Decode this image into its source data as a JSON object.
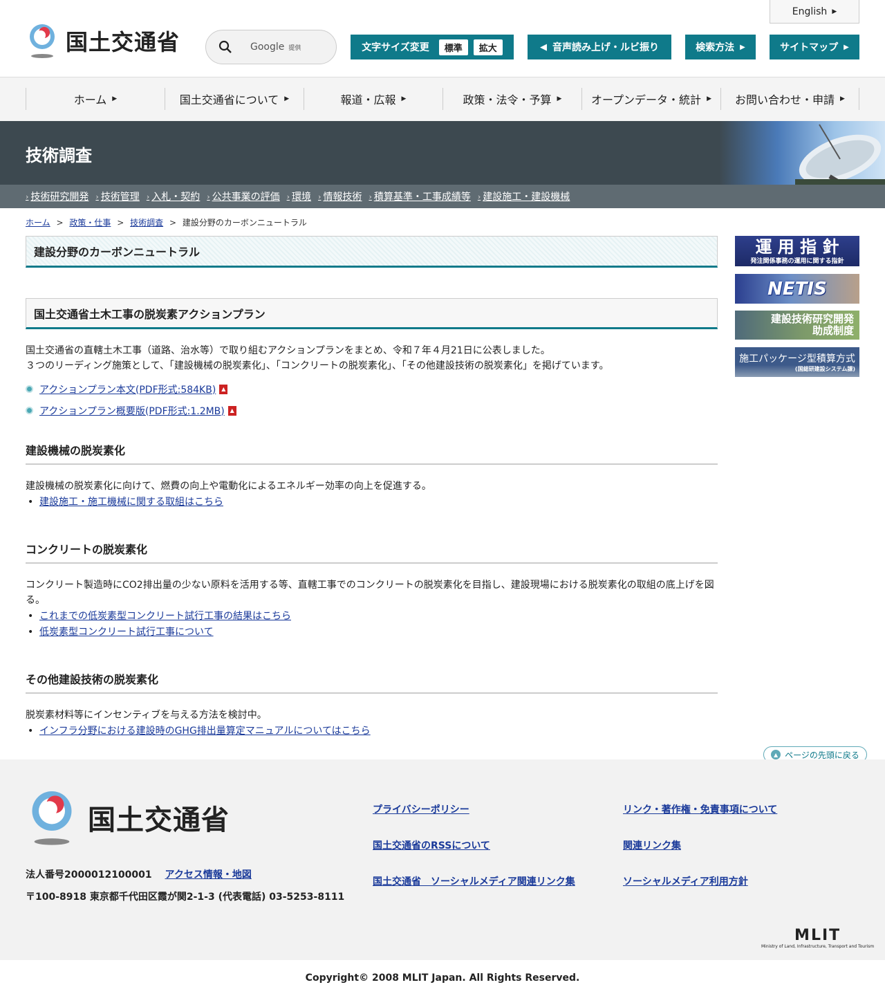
{
  "header": {
    "site_name": "国土交通省",
    "english_label": "English",
    "search_brand": "Google",
    "search_sub": "提供",
    "font_size_label": "文字サイズ変更",
    "font_standard": "標準",
    "font_large": "拡大",
    "voice_label": "音声読み上げ・ルビ振り",
    "search_method_label": "検索方法",
    "sitemap_label": "サイトマップ",
    "accent_color": "#0f7a8a"
  },
  "gnav": [
    {
      "label": "ホーム"
    },
    {
      "label": "国土交通省について"
    },
    {
      "label": "報道・広報"
    },
    {
      "label": "政策・法令・予算"
    },
    {
      "label": "オープンデータ・統計"
    },
    {
      "label": "お問い合わせ・申請"
    }
  ],
  "banner": {
    "title": "技術調査"
  },
  "subnav": [
    {
      "label": "技術研究開発"
    },
    {
      "label": "技術管理"
    },
    {
      "label": "入札・契約"
    },
    {
      "label": "公共事業の評価"
    },
    {
      "label": "環境"
    },
    {
      "label": "情報技術"
    },
    {
      "label": "積算基準・工事成績等"
    },
    {
      "label": "建設施工・建設機械"
    }
  ],
  "breadcrumb": {
    "home": "ホーム",
    "policy": "政策・仕事",
    "tech": "技術調査",
    "current": "建設分野のカーボンニュートラル",
    "sep": ">"
  },
  "main": {
    "page_title": "建設分野のカーボンニュートラル",
    "section1": {
      "heading": "国土交通省土木工事の脱炭素アクションプラン",
      "para1": "国土交通省の直轄土木工事（道路、治水等）で取り組むアクションプランをまとめ、令和７年４月21日に公表しました。",
      "para2": "３つのリーディング施策として、「建設機械の脱炭素化」、「コンクリートの脱炭素化」、「その他建設技術の脱炭素化」を掲げています。",
      "links": [
        {
          "label": "アクションプラン本文(PDF形式:584KB)"
        },
        {
          "label": "アクションプラン概要版(PDF形式:1.2MB)"
        }
      ]
    },
    "section2": {
      "heading": "建設機械の脱炭素化",
      "text": "建設機械の脱炭素化に向けて、燃費の向上や電動化によるエネルギー効率の向上を促進する。",
      "links": [
        {
          "label": "建設施工・施工機械に関する取組はこちら"
        }
      ]
    },
    "section3": {
      "heading": "コンクリートの脱炭素化",
      "text_line1": "コンクリート製造時にCO2排出量の少ない原料を活用する等、直轄工事でのコンクリートの脱炭素化を目指し、建設現場における脱炭素化の取組の底上げを図",
      "text_line2": "る。",
      "links": [
        {
          "label": "これまでの低炭素型コンクリート試行工事の結果はこちら"
        },
        {
          "label": "低炭素型コンクリート試行工事について"
        }
      ]
    },
    "section4": {
      "heading": "その他建設技術の脱炭素化",
      "text": "脱炭素材料等にインセンティブを与える方法を検討中。",
      "links": [
        {
          "label": "インフラ分野における建設時のGHG排出量算定マニュアルについてはこちら"
        }
      ]
    }
  },
  "sidebar": {
    "b1_title": "運 用 指 針",
    "b1_sub": "発注関係事務の運用に関する指針",
    "b2_title": "NETIS",
    "b3_line1": "建設技術研究開発",
    "b3_line2": "助成制度",
    "b4_title": "施工パッケージ型積算方式",
    "b4_sub": "(国総研建設システム課)"
  },
  "pagetop": {
    "label": "ページの先頭に戻る"
  },
  "footer": {
    "site_name": "国土交通省",
    "corp_number": "法人番号2000012100001",
    "access_link": "アクセス情報・地図",
    "address": "〒100-8918 東京都千代田区霞が関2-1-3 (代表電話) 03-5253-8111",
    "links": [
      {
        "label": "プライバシーポリシー"
      },
      {
        "label": "リンク・著作権・免責事項について"
      },
      {
        "label": "国土交通省のRSSについて"
      },
      {
        "label": "関連リンク集"
      },
      {
        "label": "国土交通省　ソーシャルメディア関連リンク集"
      },
      {
        "label": "ソーシャルメディア利用方針"
      }
    ],
    "mlit_logo": "MLIT",
    "mlit_sub": "Ministry of Land, Infrastructure, Transport and Tourism",
    "copyright": "Copyright© 2008 MLIT Japan. All Rights Reserved."
  }
}
